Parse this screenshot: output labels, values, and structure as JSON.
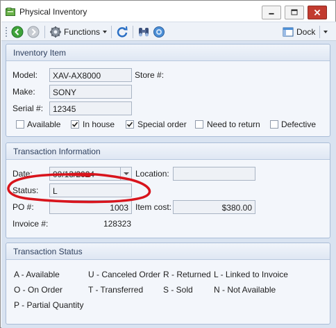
{
  "window": {
    "title": "Physical Inventory",
    "accent": "#c23b2f"
  },
  "toolbar": {
    "back_icon": "back-arrow-icon",
    "forward_icon": "forward-arrow-icon",
    "functions_label": "Functions",
    "refresh_icon": "refresh-icon",
    "binoculars_icon": "binoculars-icon",
    "help_icon": "help-icon",
    "dock_label": "Dock"
  },
  "inventory_item": {
    "title": "Inventory Item",
    "model_label": "Model:",
    "model_value": "XAV-AX8000",
    "store_label": "Store #:",
    "make_label": "Make:",
    "make_value": "SONY",
    "serial_label": "Serial #:",
    "serial_value": "12345",
    "checkboxes": [
      {
        "label": "Available",
        "checked": false
      },
      {
        "label": "In house",
        "checked": true
      },
      {
        "label": "Special order",
        "checked": true
      },
      {
        "label": "Need to return",
        "checked": false
      },
      {
        "label": "Defective",
        "checked": false
      }
    ]
  },
  "transaction_info": {
    "title": "Transaction Information",
    "date_label": "Date:",
    "date_value": "09/13/2024",
    "location_label": "Location:",
    "location_value": "",
    "status_label": "Status:",
    "status_value": "L",
    "po_label": "PO #:",
    "po_value": "1003",
    "item_cost_label": "Item cost:",
    "item_cost_value": "$380.00",
    "invoice_label": "Invoice #:",
    "invoice_value": "128323",
    "annotation_color": "#d8141c"
  },
  "transaction_status": {
    "title": "Transaction Status",
    "codes": [
      "A - Available",
      "U - Canceled Order",
      "R - Returned",
      "L - Linked to Invoice",
      "O - On Order",
      "T - Transferred",
      "S - Sold",
      "N - Not Available",
      "P - Partial Quantity"
    ]
  }
}
